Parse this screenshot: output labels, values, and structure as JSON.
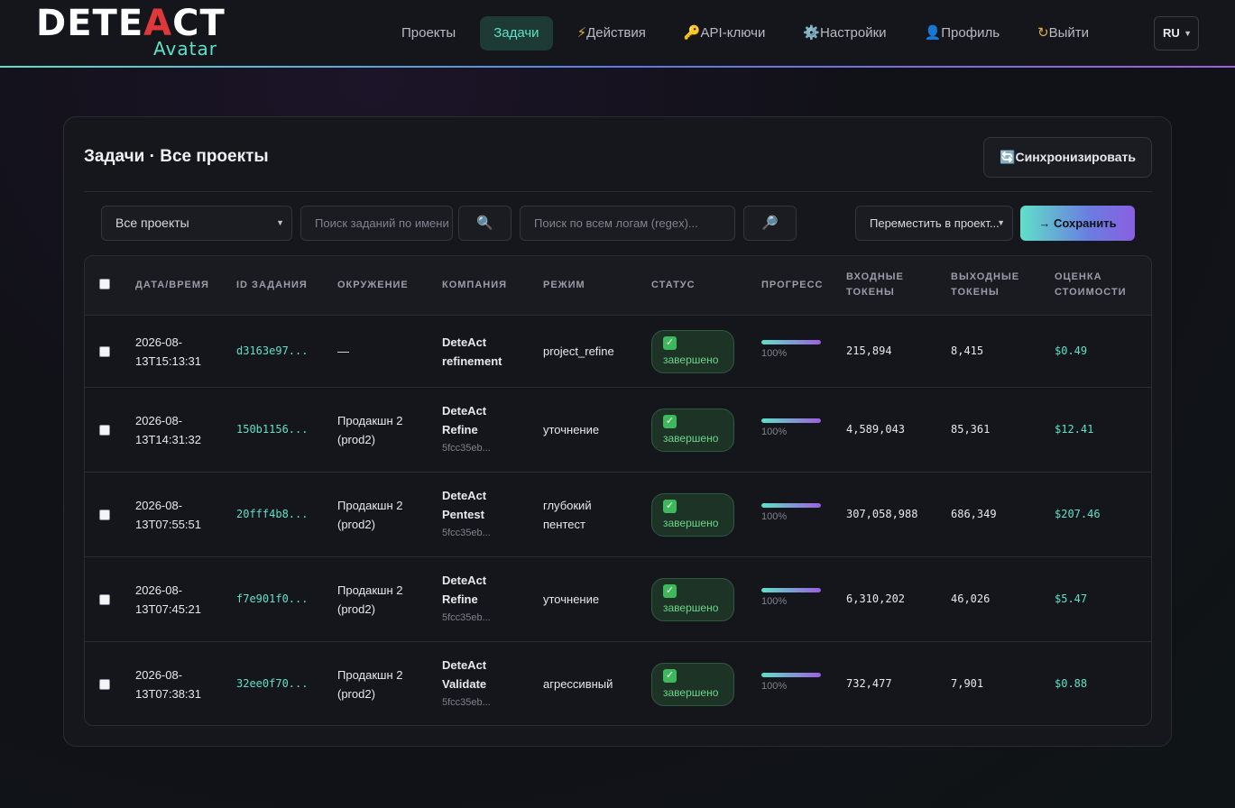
{
  "header": {
    "logo_main_a": "DETE",
    "logo_main_accent": "A",
    "logo_main_b": "CT",
    "logo_sub": "Avatar",
    "nav": [
      {
        "label": "Проекты",
        "icon": ""
      },
      {
        "label": "Задачи",
        "icon": ""
      },
      {
        "label": "Действия",
        "icon": "⚡"
      },
      {
        "label": "API-ключи",
        "icon": "🔑"
      },
      {
        "label": "Настройки",
        "icon": "⚙️"
      },
      {
        "label": "Профиль",
        "icon": "👤"
      },
      {
        "label": "Выйти",
        "icon": "↻"
      }
    ],
    "active_nav": "Задачи",
    "language": "RU"
  },
  "panel": {
    "title": "Задачи · Все проекты",
    "sync_icon": "🔄",
    "sync_label": "Синхронизировать",
    "filters": {
      "project_select": "Все проекты",
      "task_search_placeholder": "Поиск заданий по имени",
      "task_search_icon": "🔍",
      "log_search_placeholder": "Поиск по всем логам (regex)...",
      "log_search_icon": "🔎",
      "move_select": "Переместить в проект...",
      "save_label": "→ Сохранить"
    }
  },
  "table": {
    "columns": [
      "ДАТА/ВРЕМЯ",
      "ID ЗАДАНИЯ",
      "ОКРУЖЕНИЕ",
      "КОМПАНИЯ",
      "РЕЖИМ",
      "СТАТУС",
      "ПРОГРЕСС",
      "ВХОДНЫЕ ТОКЕНЫ",
      "ВЫХОДНЫЕ ТОКЕНЫ",
      "ОЦЕНКА СТОИМОСТИ"
    ],
    "rows": [
      {
        "date": "2026-08-",
        "time": "13T15:13:31",
        "id": "d3163e97...",
        "env_a": "—",
        "env_b": "",
        "company_a": "DeteAct",
        "company_b": "refinement",
        "company_id": "",
        "mode_a": "project_refine",
        "mode_b": "",
        "status": "завершено",
        "progress": 100,
        "progress_label": "100%",
        "tokens_in": "215,894",
        "tokens_out": "8,415",
        "cost": "$0.49"
      },
      {
        "date": "2026-08-",
        "time": "13T14:31:32",
        "id": "150b1156...",
        "env_a": "Продакшн 2",
        "env_b": "(prod2)",
        "company_a": "DeteAct",
        "company_b": "Refine",
        "company_id": "5fcc35eb...",
        "mode_a": "уточнение",
        "mode_b": "",
        "status": "завершено",
        "progress": 100,
        "progress_label": "100%",
        "tokens_in": "4,589,043",
        "tokens_out": "85,361",
        "cost": "$12.41"
      },
      {
        "date": "2026-08-",
        "time": "13T07:55:51",
        "id": "20fff4b8...",
        "env_a": "Продакшн 2",
        "env_b": "(prod2)",
        "company_a": "DeteAct",
        "company_b": "Pentest",
        "company_id": "5fcc35eb...",
        "mode_a": "глубокий",
        "mode_b": "пентест",
        "status": "завершено",
        "progress": 100,
        "progress_label": "100%",
        "tokens_in": "307,058,988",
        "tokens_out": "686,349",
        "cost": "$207.46"
      },
      {
        "date": "2026-08-",
        "time": "13T07:45:21",
        "id": "f7e901f0...",
        "env_a": "Продакшн 2",
        "env_b": "(prod2)",
        "company_a": "DeteAct",
        "company_b": "Refine",
        "company_id": "5fcc35eb...",
        "mode_a": "уточнение",
        "mode_b": "",
        "status": "завершено",
        "progress": 100,
        "progress_label": "100%",
        "tokens_in": "6,310,202",
        "tokens_out": "46,026",
        "cost": "$5.47"
      },
      {
        "date": "2026-08-",
        "time": "13T07:38:31",
        "id": "32ee0f70...",
        "env_a": "Продакшн 2",
        "env_b": "(prod2)",
        "company_a": "DeteAct",
        "company_b": "Validate",
        "company_id": "5fcc35eb...",
        "mode_a": "агрессивный",
        "mode_b": "",
        "status": "завершено",
        "progress": 100,
        "progress_label": "100%",
        "tokens_in": "732,477",
        "tokens_out": "7,901",
        "cost": "$0.88"
      }
    ]
  },
  "colors": {
    "accent": "#5fe0c8",
    "danger": "#e0383a",
    "success": "#6cd68a"
  }
}
